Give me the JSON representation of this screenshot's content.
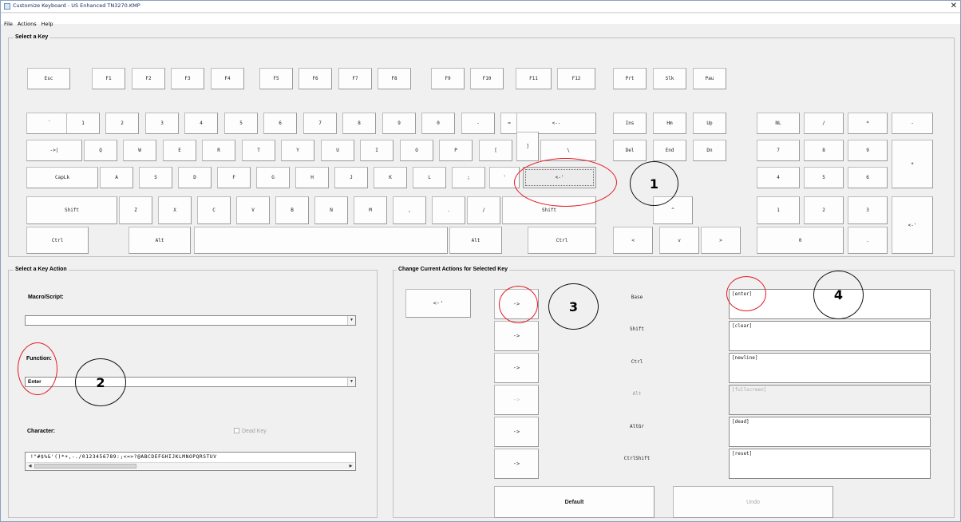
{
  "window": {
    "title": "Customize Keyboard - US Enhanced   TN3270.KMP",
    "close_glyph": "✕"
  },
  "menu": [
    "File",
    "Actions",
    "Help"
  ],
  "select_key": {
    "legend": "Select a Key",
    "keys": {
      "esc": "Esc",
      "f1": "F1",
      "f2": "F2",
      "f3": "F3",
      "f4": "F4",
      "f5": "F5",
      "f6": "F6",
      "f7": "F7",
      "f8": "F8",
      "f9": "F9",
      "f10": "F10",
      "f11": "F11",
      "f12": "F12",
      "prt": "Prt",
      "slk": "Slk",
      "pau": "Pau",
      "grave": "`",
      "d1": "1",
      "d2": "2",
      "d3": "3",
      "d4": "4",
      "d5": "5",
      "d6": "6",
      "d7": "7",
      "d8": "8",
      "d9": "9",
      "d0": "0",
      "minus": "-",
      "equals": "=",
      "backspace": "<--",
      "ins": "Ins",
      "hm": "Hm",
      "up": "Up",
      "nl": "NL",
      "npdiv": "/",
      "npmul": "*",
      "npsub": "-",
      "tab": "->|",
      "q": "Q",
      "w": "W",
      "e": "E",
      "r": "R",
      "t": "T",
      "y": "Y",
      "u": "U",
      "i": "I",
      "o": "O",
      "p": "P",
      "lbracket": "[",
      "rbracket": "]",
      "backslash": "\\",
      "del": "Del",
      "end": "End",
      "dn": "Dn",
      "np7": "7",
      "np8": "8",
      "np9": "9",
      "npadd": "+",
      "caps": "CapLk",
      "a": "A",
      "s": "S",
      "d": "D",
      "f": "F",
      "g": "G",
      "h": "H",
      "j": "J",
      "k": "K",
      "l": "L",
      "semicolon": ";",
      "quote": "'",
      "enter": "<-'",
      "np4": "4",
      "np5": "5",
      "np6": "6",
      "lshift": "Shift",
      "z": "Z",
      "x": "X",
      "c": "C",
      "v": "V",
      "b": "B",
      "n": "N",
      "m": "M",
      "comma": ",",
      "period": ".",
      "slash": "/",
      "rshift": "Shift",
      "arrow_up": "^",
      "np1": "1",
      "np2": "2",
      "np3": "3",
      "npenter": "<-'",
      "lctrl": "Ctrl",
      "lalt": "Alt",
      "space": "",
      "ralt": "Alt",
      "rctrl": "Ctrl",
      "arrow_left": "<",
      "arrow_down": "v",
      "arrow_right": ">",
      "np0": "0",
      "npdot": "."
    }
  },
  "key_action": {
    "legend": "Select a Key Action",
    "macro_label": "Macro/Script:",
    "macro_value": "",
    "function_label": "Function:",
    "function_value": "Enter",
    "character_label": "Character:",
    "dead_key_label": "Dead Key",
    "character_strip": " !\"#$%&'()*+,-./0123456789:;<=>?@ABCDEFGHIJKLMNOPQRSTUV"
  },
  "current_actions": {
    "legend": "Change Current Actions for Selected Key",
    "preview_key": "<-'",
    "assign_glyph": "->",
    "rows": [
      {
        "label": "Base",
        "value": "[enter]",
        "enabled": true
      },
      {
        "label": "Shift",
        "value": "[clear]",
        "enabled": true
      },
      {
        "label": "Ctrl",
        "value": "[newline]",
        "enabled": true
      },
      {
        "label": "Alt",
        "value": "[fullscreen]",
        "enabled": false
      },
      {
        "label": "AltGr",
        "value": "[dead]",
        "enabled": true
      },
      {
        "label": "CtrlShift",
        "value": "[reset]",
        "enabled": true
      }
    ],
    "default_label": "Default",
    "undo_label": "Undo"
  },
  "callouts": [
    "1",
    "2",
    "3",
    "4"
  ],
  "colors": {
    "highlight_ring": "#e51b24",
    "window_bg": "#f0f0f0"
  }
}
